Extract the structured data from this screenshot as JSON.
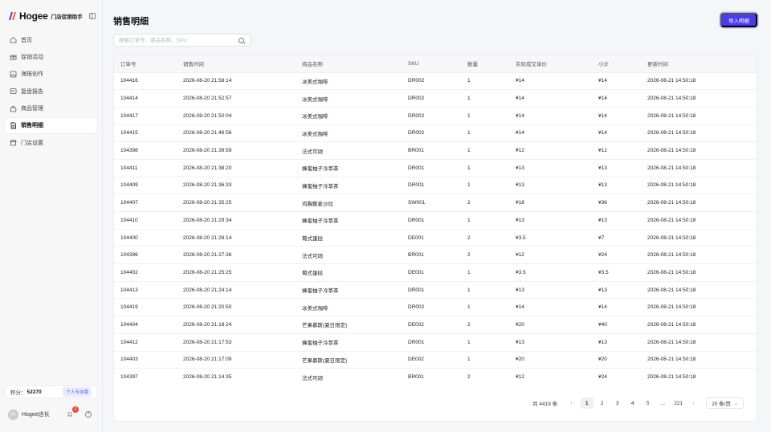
{
  "brand": {
    "name": "Hogee",
    "subtitle": "门店促销助手"
  },
  "sidebar": {
    "items": [
      {
        "label": "首页",
        "icon": "home-icon"
      },
      {
        "label": "促销活动",
        "icon": "gift-icon"
      },
      {
        "label": "海报创作",
        "icon": "image-icon"
      },
      {
        "label": "复盘报告",
        "icon": "report-icon"
      },
      {
        "label": "商品管理",
        "icon": "bag-icon"
      },
      {
        "label": "销售明细",
        "icon": "document-icon",
        "active": true
      },
      {
        "label": "门店设置",
        "icon": "store-icon"
      }
    ],
    "points_label": "积分：",
    "points_value": "52270",
    "plan_badge": "个人专业版",
    "user_initial": "H",
    "user_name": "Hogee店长",
    "notification_count": "2"
  },
  "page": {
    "title": "销售明细",
    "import_button": "导入明细",
    "search_placeholder": "搜索订单号、商品名称、SKU"
  },
  "table": {
    "columns": [
      "订单号",
      "销售时间",
      "商品名称",
      "SKU",
      "数量",
      "实际成交单价",
      "小计",
      "更新时间"
    ],
    "rows": [
      [
        "104416",
        "2026-08-20 21:58:14",
        "冰美式咖啡",
        "DR002",
        "1",
        "¥14",
        "¥14",
        "2026-08-21 14:50:18"
      ],
      [
        "104414",
        "2026-08-20 21:52:57",
        "冰美式咖啡",
        "DR002",
        "1",
        "¥14",
        "¥14",
        "2026-08-21 14:50:18"
      ],
      [
        "104417",
        "2026-08-20 21:50:04",
        "冰美式咖啡",
        "DR002",
        "1",
        "¥14",
        "¥14",
        "2026-08-21 14:50:18"
      ],
      [
        "104415",
        "2026-08-20 21:46:56",
        "冰美式咖啡",
        "DR002",
        "1",
        "¥14",
        "¥14",
        "2026-08-21 14:50:18"
      ],
      [
        "104398",
        "2026-08-20 21:39:59",
        "法式可颂",
        "BR001",
        "1",
        "¥12",
        "¥12",
        "2026-08-21 14:50:18"
      ],
      [
        "104411",
        "2026-08-20 21:38:20",
        "蜂蜜柚子冷萃茶",
        "DR001",
        "1",
        "¥13",
        "¥13",
        "2026-08-21 14:50:18"
      ],
      [
        "104409",
        "2026-08-20 21:36:33",
        "蜂蜜柚子冷萃茶",
        "DR001",
        "1",
        "¥13",
        "¥13",
        "2026-08-21 14:50:18"
      ],
      [
        "104407",
        "2026-08-20 21:35:25",
        "鸡胸藜麦沙拉",
        "SW001",
        "2",
        "¥18",
        "¥36",
        "2026-08-21 14:50:18"
      ],
      [
        "104410",
        "2026-08-20 21:29:34",
        "蜂蜜柚子冷萃茶",
        "DR001",
        "1",
        "¥13",
        "¥13",
        "2026-08-21 14:50:18"
      ],
      [
        "104400",
        "2026-08-20 21:28:14",
        "葡式蛋挞",
        "DE001",
        "2",
        "¥3.5",
        "¥7",
        "2026-08-21 14:50:18"
      ],
      [
        "104396",
        "2026-08-20 21:27:36",
        "法式可颂",
        "BR001",
        "2",
        "¥12",
        "¥24",
        "2026-08-21 14:50:18"
      ],
      [
        "104402",
        "2026-08-20 21:25:25",
        "葡式蛋挞",
        "DE001",
        "1",
        "¥3.5",
        "¥3.5",
        "2026-08-21 14:50:18"
      ],
      [
        "104413",
        "2026-08-20 21:24:14",
        "蜂蜜柚子冷萃茶",
        "DR001",
        "1",
        "¥13",
        "¥13",
        "2026-08-21 14:50:18"
      ],
      [
        "104419",
        "2026-08-20 21:20:50",
        "冰美式咖啡",
        "DR002",
        "1",
        "¥14",
        "¥14",
        "2026-08-21 14:50:18"
      ],
      [
        "104404",
        "2026-08-20 21:18:24",
        "芒果慕斯(夏日限定)",
        "DE002",
        "2",
        "¥20",
        "¥40",
        "2026-08-21 14:50:18"
      ],
      [
        "104412",
        "2026-08-20 21:17:53",
        "蜂蜜柚子冷萃茶",
        "DR001",
        "1",
        "¥13",
        "¥13",
        "2026-08-21 14:50:18"
      ],
      [
        "104403",
        "2026-08-20 21:17:09",
        "芒果慕斯(夏日限定)",
        "DE002",
        "1",
        "¥20",
        "¥20",
        "2026-08-21 14:50:18"
      ],
      [
        "104397",
        "2026-08-20 21:14:35",
        "法式可颂",
        "BR001",
        "2",
        "¥12",
        "¥24",
        "2026-08-21 14:50:18"
      ]
    ]
  },
  "pagination": {
    "total": "共 4419 条",
    "pages": [
      "1",
      "2",
      "3",
      "4",
      "5",
      "...",
      "221"
    ],
    "current": "1",
    "page_size": "20 条/页"
  },
  "colors": {
    "accent": "#4a3de8",
    "badge": "#f04438"
  }
}
